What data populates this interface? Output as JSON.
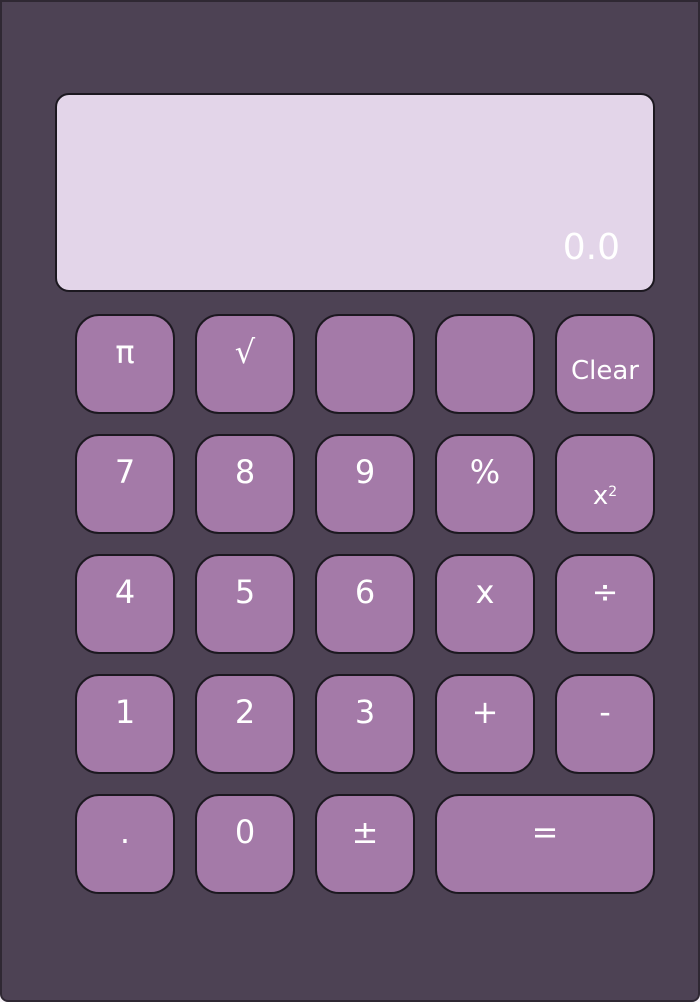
{
  "display": {
    "value": "0.0"
  },
  "keys": {
    "pi": "π",
    "sqrt": "√",
    "blank_1": "",
    "blank_2": "",
    "clear": "Clear",
    "seven": "7",
    "eight": "8",
    "nine": "9",
    "percent": "%",
    "square_base": "x",
    "square_exp": "2",
    "four": "4",
    "five": "5",
    "six": "6",
    "multiply": "x",
    "divide": "÷",
    "one": "1",
    "two": "2",
    "three": "3",
    "plus": "+",
    "minus": "-",
    "decimal": ".",
    "zero": "0",
    "plus_minus": "±",
    "equals": "="
  },
  "colors": {
    "body": "#4d4254",
    "display": "#e3d5e9",
    "key": "#a47aa8",
    "text": "#ffffff"
  }
}
